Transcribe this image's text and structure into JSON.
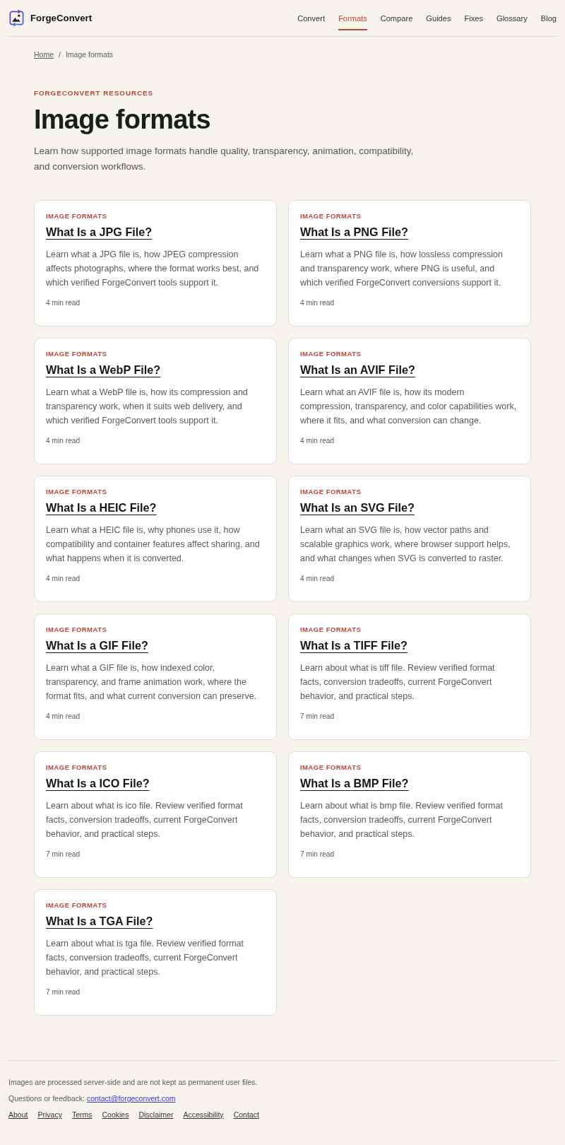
{
  "header": {
    "brand": "ForgeConvert",
    "nav": [
      {
        "label": "Convert",
        "selected": false
      },
      {
        "label": "Formats",
        "selected": true
      },
      {
        "label": "Compare",
        "selected": false
      },
      {
        "label": "Guides",
        "selected": false
      },
      {
        "label": "Fixes",
        "selected": false
      },
      {
        "label": "Glossary",
        "selected": false
      },
      {
        "label": "Blog",
        "selected": false
      }
    ]
  },
  "breadcrumb": {
    "separator": "/",
    "items": [
      {
        "label": "Home",
        "kind": "link"
      },
      {
        "label": "Image formats",
        "kind": "current"
      }
    ]
  },
  "hero": {
    "eyebrow": "FORGECONVERT RESOURCES",
    "title": "Image formats",
    "intro": "Learn how supported image formats handle quality, transparency, animation, compatibility, and conversion workflows."
  },
  "articles": [
    {
      "category": "IMAGE FORMATS",
      "title": "What Is a JPG File?",
      "summary": "Learn what a JPG file is, how JPEG compression affects photographs, where the format works best, and which verified ForgeConvert tools support it.",
      "read_time": "4 min read"
    },
    {
      "category": "IMAGE FORMATS",
      "title": "What Is a PNG File?",
      "summary": "Learn what a PNG file is, how lossless compression and transparency work, where PNG is useful, and which verified ForgeConvert conversions support it.",
      "read_time": "4 min read"
    },
    {
      "category": "IMAGE FORMATS",
      "title": "What Is a WebP File?",
      "summary": "Learn what a WebP file is, how its compression and transparency work, when it suits web delivery, and which verified ForgeConvert tools support it.",
      "read_time": "4 min read"
    },
    {
      "category": "IMAGE FORMATS",
      "title": "What Is an AVIF File?",
      "summary": "Learn what an AVIF file is, how its modern compression, transparency, and color capabilities work, where it fits, and what conversion can change.",
      "read_time": "4 min read"
    },
    {
      "category": "IMAGE FORMATS",
      "title": "What Is a HEIC File?",
      "summary": "Learn what a HEIC file is, why phones use it, how compatibility and container features affect sharing, and what happens when it is converted.",
      "read_time": "4 min read"
    },
    {
      "category": "IMAGE FORMATS",
      "title": "What Is an SVG File?",
      "summary": "Learn what an SVG file is, how vector paths and scalable graphics work, where browser support helps, and what changes when SVG is converted to raster.",
      "read_time": "4 min read"
    },
    {
      "category": "IMAGE FORMATS",
      "title": "What Is a GIF File?",
      "summary": "Learn what a GIF file is, how indexed color, transparency, and frame animation work, where the format fits, and what current conversion can preserve.",
      "read_time": "4 min read"
    },
    {
      "category": "IMAGE FORMATS",
      "title": "What Is a TIFF File?",
      "summary": "Learn about what is tiff file. Review verified format facts, conversion tradeoffs, current ForgeConvert behavior, and practical steps.",
      "read_time": "7 min read"
    },
    {
      "category": "IMAGE FORMATS",
      "title": "What Is a ICO File?",
      "summary": "Learn about what is ico file. Review verified format facts, conversion tradeoffs, current ForgeConvert behavior, and practical steps.",
      "read_time": "7 min read"
    },
    {
      "category": "IMAGE FORMATS",
      "title": "What Is a BMP File?",
      "summary": "Learn about what is bmp file. Review verified format facts, conversion tradeoffs, current ForgeConvert behavior, and practical steps.",
      "read_time": "7 min read"
    },
    {
      "category": "IMAGE FORMATS",
      "title": "What Is a TGA File?",
      "summary": "Learn about what is tga file. Review verified format facts, conversion tradeoffs, current ForgeConvert behavior, and practical steps.",
      "read_time": "7 min read"
    }
  ],
  "footer": {
    "notice": "Images are processed server-side and are not kept as permanent user files.",
    "contact": {
      "label": "Questions or feedback:",
      "email": "contact@forgeconvert.com"
    },
    "links": [
      "About",
      "Privacy",
      "Terms",
      "Cookies",
      "Disclaimer",
      "Accessibility",
      "Contact"
    ]
  }
}
